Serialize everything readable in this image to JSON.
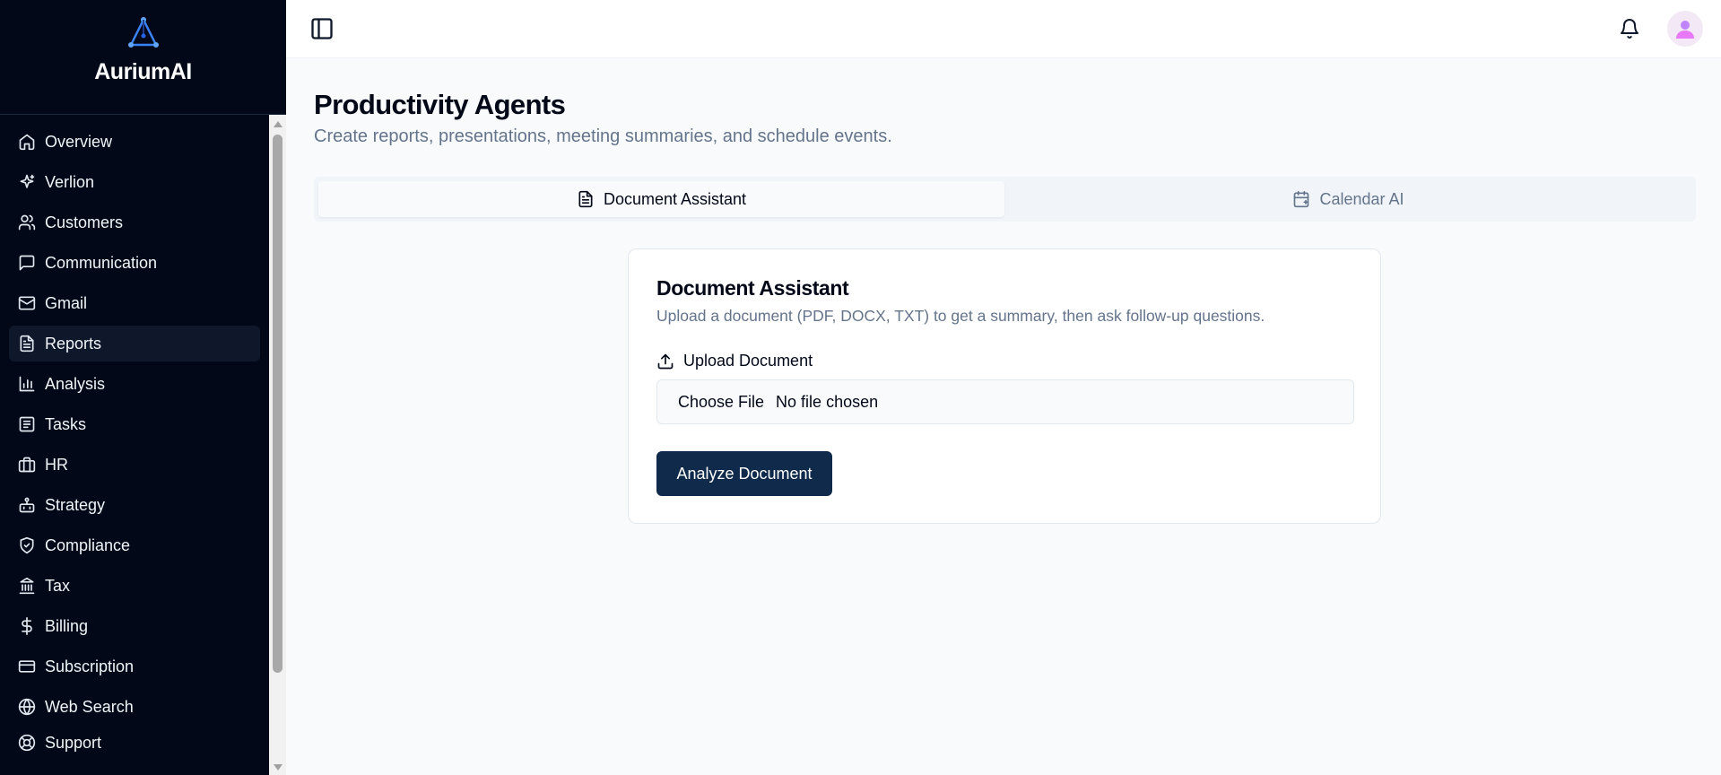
{
  "brand": {
    "name": "AuriumAI",
    "logo_icon": "triangle-network-logo"
  },
  "sidebar": {
    "items": [
      {
        "label": "Overview",
        "icon": "home-icon",
        "active": false
      },
      {
        "label": "Verlion",
        "icon": "sparkles-icon",
        "active": false
      },
      {
        "label": "Customers",
        "icon": "users-icon",
        "active": false
      },
      {
        "label": "Communication",
        "icon": "message-square-icon",
        "active": false
      },
      {
        "label": "Gmail",
        "icon": "mail-icon",
        "active": false
      },
      {
        "label": "Reports",
        "icon": "file-text-icon",
        "active": true
      },
      {
        "label": "Analysis",
        "icon": "bar-chart-icon",
        "active": false
      },
      {
        "label": "Tasks",
        "icon": "list-icon",
        "active": false
      },
      {
        "label": "HR",
        "icon": "briefcase-icon",
        "active": false
      },
      {
        "label": "Strategy",
        "icon": "bot-icon",
        "active": false
      },
      {
        "label": "Compliance",
        "icon": "shield-check-icon",
        "active": false
      },
      {
        "label": "Tax",
        "icon": "landmark-icon",
        "active": false
      },
      {
        "label": "Billing",
        "icon": "dollar-icon",
        "active": false
      },
      {
        "label": "Subscription",
        "icon": "credit-card-icon",
        "active": false
      },
      {
        "label": "Web Search",
        "icon": "globe-icon",
        "active": false
      },
      {
        "label": "Support",
        "icon": "life-buoy-icon",
        "active": false
      }
    ]
  },
  "header": {
    "toggle_icon": "panel-left-icon",
    "notification_icon": "bell-icon",
    "avatar_icon": "user-avatar-icon"
  },
  "main": {
    "title": "Productivity Agents",
    "subtitle": "Create reports, presentations, meeting summaries, and schedule events.",
    "tabs": [
      {
        "label": "Document Assistant",
        "icon": "file-text-icon",
        "active": true
      },
      {
        "label": "Calendar AI",
        "icon": "calendar-plus-icon",
        "active": false
      }
    ],
    "card": {
      "title": "Document Assistant",
      "description": "Upload a document (PDF, DOCX, TXT) to get a summary, then ask follow-up questions.",
      "upload_label": "Upload Document",
      "file_button": "Choose File",
      "file_status": "No file chosen",
      "analyze_button": "Analyze Document"
    }
  },
  "colors": {
    "sidebar_bg": "#020817",
    "primary_button": "#0f2a4a",
    "muted_text": "#64748b",
    "page_bg": "#f8fafc"
  }
}
